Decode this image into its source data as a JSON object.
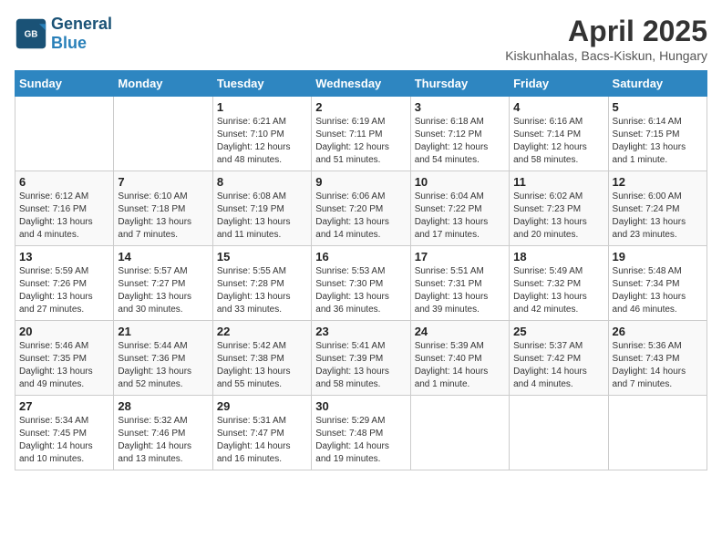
{
  "header": {
    "logo_general": "General",
    "logo_blue": "Blue",
    "title": "April 2025",
    "subtitle": "Kiskunhalas, Bacs-Kiskun, Hungary"
  },
  "calendar": {
    "days_of_week": [
      "Sunday",
      "Monday",
      "Tuesday",
      "Wednesday",
      "Thursday",
      "Friday",
      "Saturday"
    ],
    "weeks": [
      [
        {
          "day": "",
          "sunrise": "",
          "sunset": "",
          "daylight": ""
        },
        {
          "day": "",
          "sunrise": "",
          "sunset": "",
          "daylight": ""
        },
        {
          "day": "1",
          "sunrise": "Sunrise: 6:21 AM",
          "sunset": "Sunset: 7:10 PM",
          "daylight": "Daylight: 12 hours and 48 minutes."
        },
        {
          "day": "2",
          "sunrise": "Sunrise: 6:19 AM",
          "sunset": "Sunset: 7:11 PM",
          "daylight": "Daylight: 12 hours and 51 minutes."
        },
        {
          "day": "3",
          "sunrise": "Sunrise: 6:18 AM",
          "sunset": "Sunset: 7:12 PM",
          "daylight": "Daylight: 12 hours and 54 minutes."
        },
        {
          "day": "4",
          "sunrise": "Sunrise: 6:16 AM",
          "sunset": "Sunset: 7:14 PM",
          "daylight": "Daylight: 12 hours and 58 minutes."
        },
        {
          "day": "5",
          "sunrise": "Sunrise: 6:14 AM",
          "sunset": "Sunset: 7:15 PM",
          "daylight": "Daylight: 13 hours and 1 minute."
        }
      ],
      [
        {
          "day": "6",
          "sunrise": "Sunrise: 6:12 AM",
          "sunset": "Sunset: 7:16 PM",
          "daylight": "Daylight: 13 hours and 4 minutes."
        },
        {
          "day": "7",
          "sunrise": "Sunrise: 6:10 AM",
          "sunset": "Sunset: 7:18 PM",
          "daylight": "Daylight: 13 hours and 7 minutes."
        },
        {
          "day": "8",
          "sunrise": "Sunrise: 6:08 AM",
          "sunset": "Sunset: 7:19 PM",
          "daylight": "Daylight: 13 hours and 11 minutes."
        },
        {
          "day": "9",
          "sunrise": "Sunrise: 6:06 AM",
          "sunset": "Sunset: 7:20 PM",
          "daylight": "Daylight: 13 hours and 14 minutes."
        },
        {
          "day": "10",
          "sunrise": "Sunrise: 6:04 AM",
          "sunset": "Sunset: 7:22 PM",
          "daylight": "Daylight: 13 hours and 17 minutes."
        },
        {
          "day": "11",
          "sunrise": "Sunrise: 6:02 AM",
          "sunset": "Sunset: 7:23 PM",
          "daylight": "Daylight: 13 hours and 20 minutes."
        },
        {
          "day": "12",
          "sunrise": "Sunrise: 6:00 AM",
          "sunset": "Sunset: 7:24 PM",
          "daylight": "Daylight: 13 hours and 23 minutes."
        }
      ],
      [
        {
          "day": "13",
          "sunrise": "Sunrise: 5:59 AM",
          "sunset": "Sunset: 7:26 PM",
          "daylight": "Daylight: 13 hours and 27 minutes."
        },
        {
          "day": "14",
          "sunrise": "Sunrise: 5:57 AM",
          "sunset": "Sunset: 7:27 PM",
          "daylight": "Daylight: 13 hours and 30 minutes."
        },
        {
          "day": "15",
          "sunrise": "Sunrise: 5:55 AM",
          "sunset": "Sunset: 7:28 PM",
          "daylight": "Daylight: 13 hours and 33 minutes."
        },
        {
          "day": "16",
          "sunrise": "Sunrise: 5:53 AM",
          "sunset": "Sunset: 7:30 PM",
          "daylight": "Daylight: 13 hours and 36 minutes."
        },
        {
          "day": "17",
          "sunrise": "Sunrise: 5:51 AM",
          "sunset": "Sunset: 7:31 PM",
          "daylight": "Daylight: 13 hours and 39 minutes."
        },
        {
          "day": "18",
          "sunrise": "Sunrise: 5:49 AM",
          "sunset": "Sunset: 7:32 PM",
          "daylight": "Daylight: 13 hours and 42 minutes."
        },
        {
          "day": "19",
          "sunrise": "Sunrise: 5:48 AM",
          "sunset": "Sunset: 7:34 PM",
          "daylight": "Daylight: 13 hours and 46 minutes."
        }
      ],
      [
        {
          "day": "20",
          "sunrise": "Sunrise: 5:46 AM",
          "sunset": "Sunset: 7:35 PM",
          "daylight": "Daylight: 13 hours and 49 minutes."
        },
        {
          "day": "21",
          "sunrise": "Sunrise: 5:44 AM",
          "sunset": "Sunset: 7:36 PM",
          "daylight": "Daylight: 13 hours and 52 minutes."
        },
        {
          "day": "22",
          "sunrise": "Sunrise: 5:42 AM",
          "sunset": "Sunset: 7:38 PM",
          "daylight": "Daylight: 13 hours and 55 minutes."
        },
        {
          "day": "23",
          "sunrise": "Sunrise: 5:41 AM",
          "sunset": "Sunset: 7:39 PM",
          "daylight": "Daylight: 13 hours and 58 minutes."
        },
        {
          "day": "24",
          "sunrise": "Sunrise: 5:39 AM",
          "sunset": "Sunset: 7:40 PM",
          "daylight": "Daylight: 14 hours and 1 minute."
        },
        {
          "day": "25",
          "sunrise": "Sunrise: 5:37 AM",
          "sunset": "Sunset: 7:42 PM",
          "daylight": "Daylight: 14 hours and 4 minutes."
        },
        {
          "day": "26",
          "sunrise": "Sunrise: 5:36 AM",
          "sunset": "Sunset: 7:43 PM",
          "daylight": "Daylight: 14 hours and 7 minutes."
        }
      ],
      [
        {
          "day": "27",
          "sunrise": "Sunrise: 5:34 AM",
          "sunset": "Sunset: 7:45 PM",
          "daylight": "Daylight: 14 hours and 10 minutes."
        },
        {
          "day": "28",
          "sunrise": "Sunrise: 5:32 AM",
          "sunset": "Sunset: 7:46 PM",
          "daylight": "Daylight: 14 hours and 13 minutes."
        },
        {
          "day": "29",
          "sunrise": "Sunrise: 5:31 AM",
          "sunset": "Sunset: 7:47 PM",
          "daylight": "Daylight: 14 hours and 16 minutes."
        },
        {
          "day": "30",
          "sunrise": "Sunrise: 5:29 AM",
          "sunset": "Sunset: 7:48 PM",
          "daylight": "Daylight: 14 hours and 19 minutes."
        },
        {
          "day": "",
          "sunrise": "",
          "sunset": "",
          "daylight": ""
        },
        {
          "day": "",
          "sunrise": "",
          "sunset": "",
          "daylight": ""
        },
        {
          "day": "",
          "sunrise": "",
          "sunset": "",
          "daylight": ""
        }
      ]
    ]
  }
}
